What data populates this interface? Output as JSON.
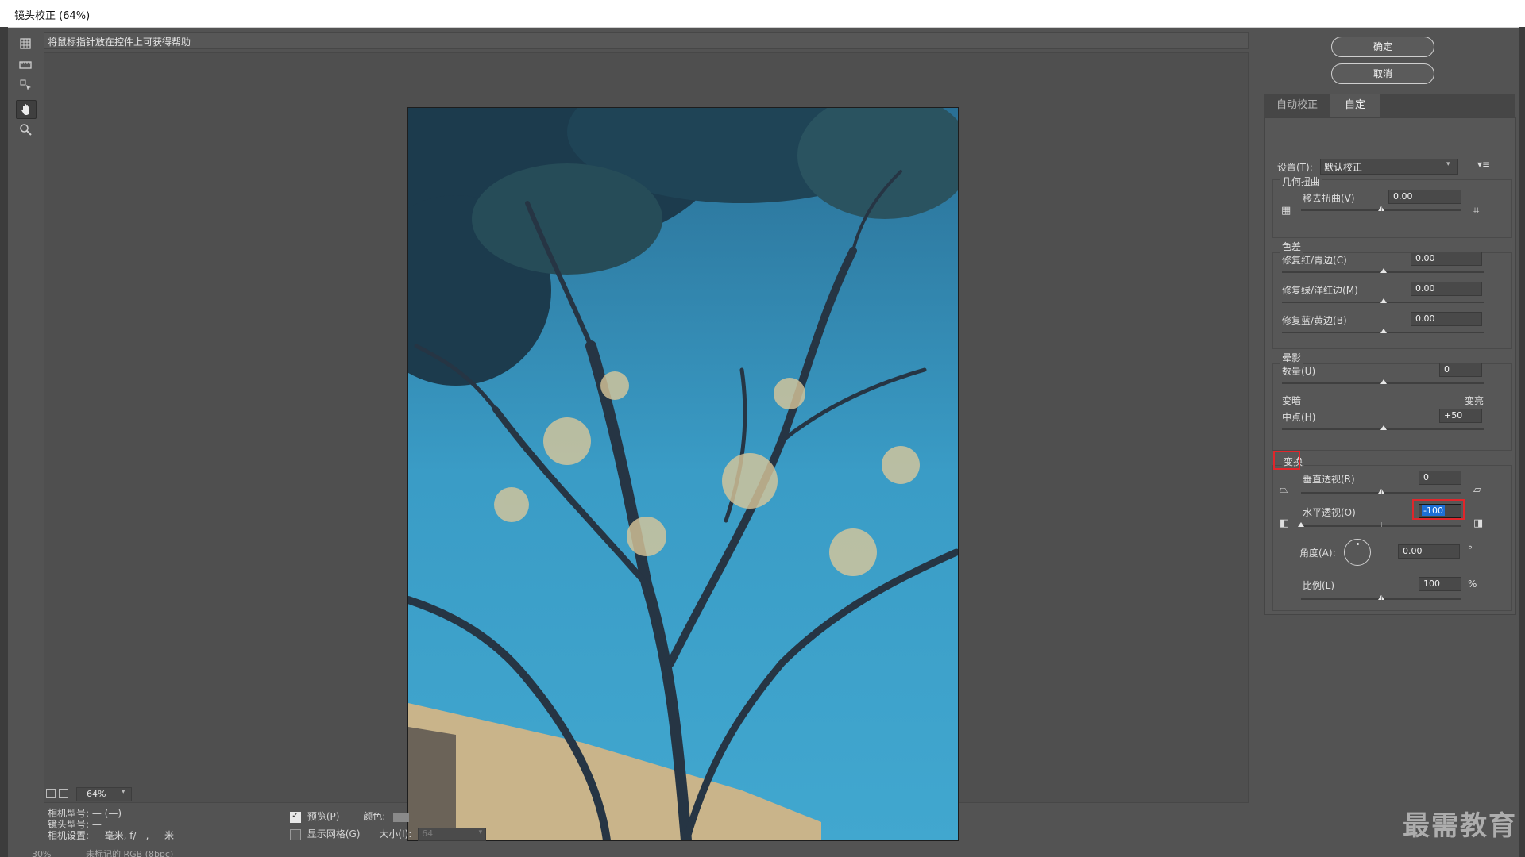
{
  "window": {
    "title": "镜头校正 (64%)"
  },
  "hint": "将鼠标指针放在控件上可获得帮助",
  "tools": [
    {
      "name": "remove-distortion-tool-icon"
    },
    {
      "name": "straighten-tool-icon"
    },
    {
      "name": "move-grid-tool-icon"
    },
    {
      "name": "hand-tool-icon",
      "active": true
    },
    {
      "name": "zoom-tool-icon"
    }
  ],
  "zoom": {
    "value": "64%"
  },
  "camera_info": {
    "model_line": "相机型号: — (—)",
    "lens_line": "镜头型号: —",
    "settings_line": "相机设置: — 毫米, f/—, — 米"
  },
  "bottom": {
    "preview_label": "预览(P)",
    "preview_checked": true,
    "color_label": "颜色:",
    "grid_label": "显示网格(G)",
    "grid_checked": false,
    "size_label": "大小(I):",
    "size_value": "64"
  },
  "buttons": {
    "ok": "确定",
    "cancel": "取消"
  },
  "tabs": [
    {
      "label": "自动校正"
    },
    {
      "label": "自定"
    }
  ],
  "settings": {
    "label": "设置(T):",
    "value": "默认校正"
  },
  "geometric": {
    "title": "几何扭曲",
    "remove_label": "移去扭曲(V)",
    "remove_value": "0.00",
    "remove_level": 0.5
  },
  "chromatic": {
    "title": "色差",
    "red_label": "修复红/青边(C)",
    "red_value": "0.00",
    "red_level": 0.5,
    "green_label": "修复绿/洋红边(M)",
    "green_value": "0.00",
    "green_level": 0.5,
    "blue_label": "修复蓝/黄边(B)",
    "blue_value": "0.00",
    "blue_level": 0.5
  },
  "vignette": {
    "title": "晕影",
    "amount_label": "数量(U)",
    "amount_value": "0",
    "amount_level": 0.5,
    "darken_label": "变暗",
    "lighten_label": "变亮",
    "midpoint_label": "中点(H)",
    "midpoint_value": "+50",
    "midpoint_level": 0.5
  },
  "transform": {
    "title": "变换",
    "vertical_label": "垂直透视(R)",
    "vertical_value": "0",
    "vertical_level": 0.5,
    "horizontal_label": "水平透视(O)",
    "horizontal_value": "-100",
    "horizontal_level": 0.0,
    "angle_label": "角度(A):",
    "angle_value": "0.00",
    "angle_unit": "°",
    "scale_label": "比例(L)",
    "scale_value": "100",
    "scale_unit": "%",
    "scale_level": 0.5
  },
  "footer_status": {
    "zoom": "30%",
    "doc": "未标记的 RGB (8bpc)"
  },
  "watermark": "最需教育",
  "colors": {
    "accent_red": "#e0262b",
    "selection": "#1e6fd6"
  }
}
